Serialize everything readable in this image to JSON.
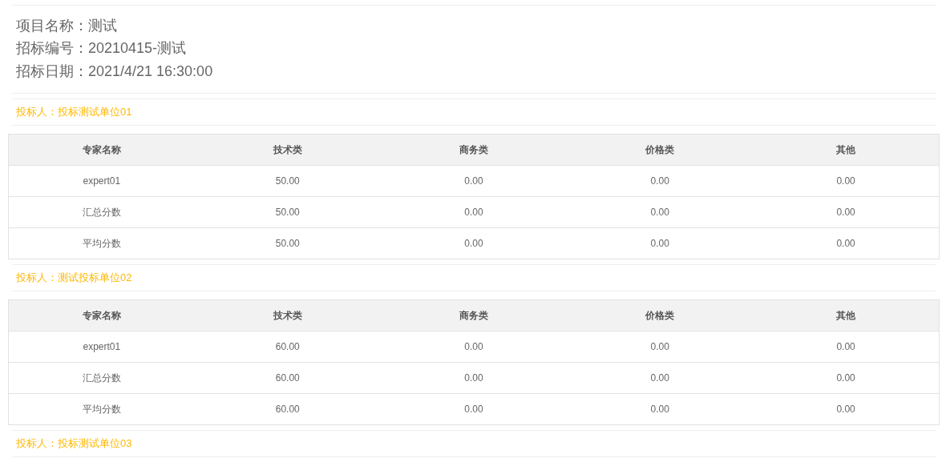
{
  "project": [
    {
      "label": "项目名称：",
      "value": "测试"
    },
    {
      "label": "招标编号：",
      "value": "20210415-测试"
    },
    {
      "label": "招标日期：",
      "value": "2021/4/21 16:30:00"
    }
  ],
  "bidders": [
    {
      "title": "投标人：投标测试单位01",
      "table": {
        "columns": [
          "专家名称",
          "技术类",
          "商务类",
          "价格类",
          "其他"
        ],
        "rows": [
          [
            "expert01",
            "50.00",
            "0.00",
            "0.00",
            "0.00"
          ],
          [
            "汇总分数",
            "50.00",
            "0.00",
            "0.00",
            "0.00"
          ],
          [
            "平均分数",
            "50.00",
            "0.00",
            "0.00",
            "0.00"
          ]
        ]
      }
    },
    {
      "title": "投标人：测试投标单位02",
      "table": {
        "columns": [
          "专家名称",
          "技术类",
          "商务类",
          "价格类",
          "其他"
        ],
        "rows": [
          [
            "expert01",
            "60.00",
            "0.00",
            "0.00",
            "0.00"
          ],
          [
            "汇总分数",
            "60.00",
            "0.00",
            "0.00",
            "0.00"
          ],
          [
            "平均分数",
            "60.00",
            "0.00",
            "0.00",
            "0.00"
          ]
        ]
      }
    },
    {
      "title": "投标人：投标测试单位03"
    }
  ]
}
